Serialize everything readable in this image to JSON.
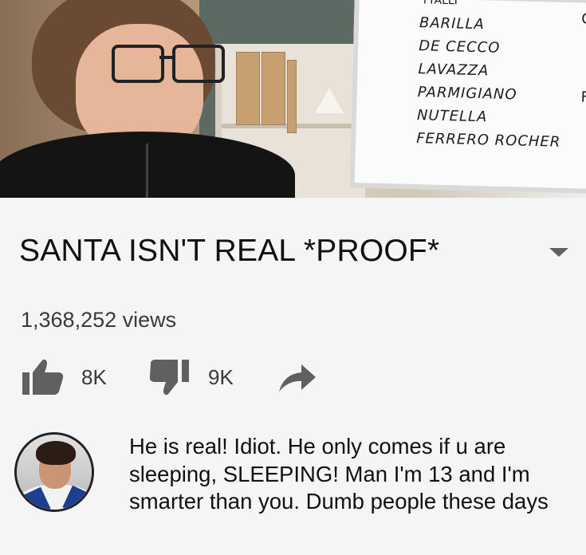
{
  "whiteboard": {
    "items": [
      "BARILLA",
      "DE CECCO",
      "LAVAZZA",
      "PARMIGIANO",
      "NUTELLA",
      "FERRERO ROCHER"
    ],
    "top_partial": "TTALLI",
    "edge_c": "C",
    "edge_f": "F"
  },
  "video": {
    "title": "SANTA ISN'T REAL *PROOF*",
    "views": "1,368,252 views",
    "likes": "8K",
    "dislikes": "9K"
  },
  "icons": {
    "expand": "chevron-down-icon",
    "like": "thumbs-up-icon",
    "dislike": "thumbs-down-icon",
    "share": "share-arrow-icon"
  },
  "colors": {
    "icon": "#606060",
    "text": "#111111",
    "background": "#f5f5f5"
  },
  "comment": {
    "text": "He is real! Idiot. He only comes if u are sleeping, SLEEPING! Man I'm 13 and I'm smarter than you. Dumb people these days"
  }
}
